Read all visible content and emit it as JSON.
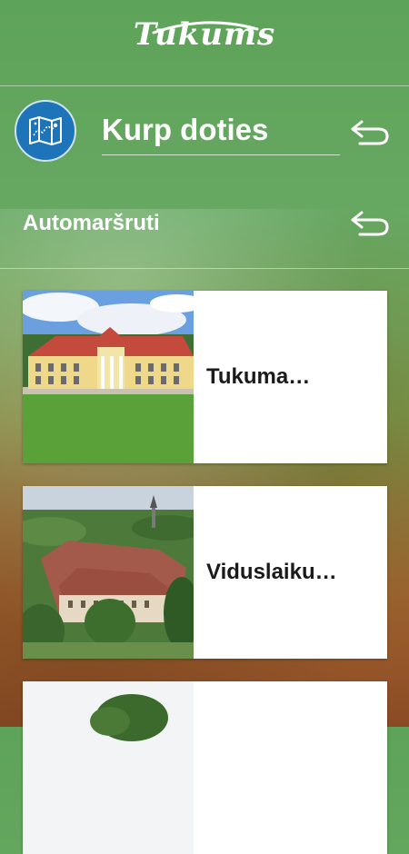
{
  "app": {
    "logo": "Tukums"
  },
  "header": {
    "title": "Kurp doties",
    "map_icon": "map-icon",
    "back_icon": "undo-arrow-icon"
  },
  "section": {
    "title": "Automaršruti",
    "back_icon": "undo-arrow-icon"
  },
  "routes": [
    {
      "label": "Tukuma…",
      "image": "manor-house-photo"
    },
    {
      "label": "Viduslaiku…",
      "image": "castle-aerial-photo"
    },
    {
      "label": "",
      "image": "tree-photo"
    }
  ],
  "colors": {
    "background_top": "#5ea35a",
    "badge": "#1e74b8",
    "card": "#ffffff"
  }
}
